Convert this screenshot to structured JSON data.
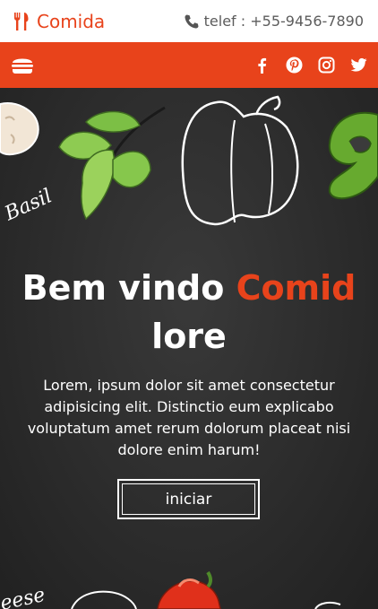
{
  "brand": {
    "name": "Comida",
    "icon": "utensils-icon"
  },
  "contact": {
    "phone_label": "telef : +55-9456-7890",
    "icon": "phone-icon"
  },
  "nav": {
    "menu_icon": "hamburger-icon",
    "social": [
      "facebook-icon",
      "pinterest-icon",
      "instagram-icon",
      "twitter-icon"
    ]
  },
  "hero": {
    "title_prefix": "Bem vindo",
    "title_accent": "Comid",
    "title_suffix": "lore",
    "text": "Lorem, ipsum dolor sit amet consectetur adipisicing elit. Distinctio eum explicabo voluptatum amet rerum dolorum placeat nisi dolore enim harum!",
    "button_label": "iniciar",
    "sketch_label_top": "Basil",
    "sketch_label_bottom": "eese"
  },
  "colors": {
    "accent": "#e8431b",
    "dark": "#2c2c2c"
  }
}
